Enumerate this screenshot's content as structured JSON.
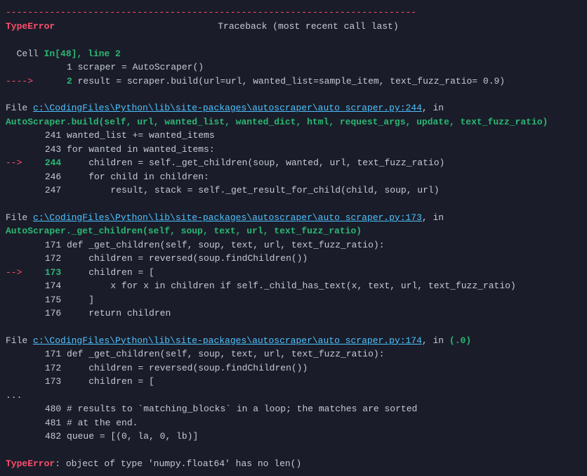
{
  "header": {
    "dashes": "---------------------------------------------------------------------------",
    "error_type": "TypeError",
    "traceback_label": "Traceback (most recent call last)",
    "cell_prefix": "Cell ",
    "in_label": "In[48]",
    "line_sep": ", ",
    "line_label": "line 2"
  },
  "cell_lines": [
    {
      "arrow": "      ",
      "num": "1",
      "code": " scraper = AutoScraper()"
    },
    {
      "arrow": "----> ",
      "num": "2",
      "code": " result = scraper.build(url=url, wanted_list=sample_item, text_fuzz_ratio= 0.9)"
    }
  ],
  "frame1": {
    "file_prefix": "File ",
    "path": "c:\\CodingFiles\\Python\\lib\\site-packages\\autoscraper\\auto_scraper.py:244",
    "in_suffix": ", in",
    "sig": "AutoScraper.build(self, url, wanted_list, wanted_dict, html, request_args, update, text_fuzz_ratio)",
    "lines": [
      {
        "arrow": "    ",
        "num": "241",
        "code": " wanted_list += wanted_items"
      },
      {
        "arrow": "    ",
        "num": "243",
        "code": " for wanted in wanted_items:"
      },
      {
        "arrow": "--> ",
        "num": "244",
        "code": "     children = self._get_children(soup, wanted, url, text_fuzz_ratio)"
      },
      {
        "arrow": "    ",
        "num": "246",
        "code": "     for child in children:"
      },
      {
        "arrow": "    ",
        "num": "247",
        "code": "         result, stack = self._get_result_for_child(child, soup, url)"
      }
    ]
  },
  "frame2": {
    "file_prefix": "File ",
    "path": "c:\\CodingFiles\\Python\\lib\\site-packages\\autoscraper\\auto_scraper.py:173",
    "in_suffix": ", in",
    "sig": "AutoScraper._get_children(self, soup, text, url, text_fuzz_ratio)",
    "lines": [
      {
        "arrow": "    ",
        "num": "171",
        "code": " def _get_children(self, soup, text, url, text_fuzz_ratio):"
      },
      {
        "arrow": "    ",
        "num": "172",
        "code": "     children = reversed(soup.findChildren())"
      },
      {
        "arrow": "--> ",
        "num": "173",
        "code": "     children = ["
      },
      {
        "arrow": "    ",
        "num": "174",
        "code": "         x for x in children if self._child_has_text(x, text, url, text_fuzz_ratio)"
      },
      {
        "arrow": "    ",
        "num": "175",
        "code": "     ]"
      },
      {
        "arrow": "    ",
        "num": "176",
        "code": "     return children"
      }
    ]
  },
  "frame3": {
    "file_prefix": "File ",
    "path": "c:\\CodingFiles\\Python\\lib\\site-packages\\autoscraper\\auto_scraper.py:174",
    "in_suffix": ", in ",
    "sig": "(.0)",
    "lines": [
      {
        "arrow": "    ",
        "num": "171",
        "code": " def _get_children(self, soup, text, url, text_fuzz_ratio):"
      },
      {
        "arrow": "    ",
        "num": "172",
        "code": "     children = reversed(soup.findChildren())"
      },
      {
        "arrow": "    ",
        "num": "173",
        "code": "     children = ["
      }
    ],
    "ellipsis": "...",
    "lines2": [
      {
        "arrow": "    ",
        "num": "480",
        "code": " # results to `matching_blocks` in a loop; the matches are sorted"
      },
      {
        "arrow": "    ",
        "num": "481",
        "code": " # at the end."
      },
      {
        "arrow": "    ",
        "num": "482",
        "code": " queue = [(0, la, 0, lb)]"
      }
    ]
  },
  "footer": {
    "error_type": "TypeError",
    "msg": ": object of type 'numpy.float64' has no len()"
  }
}
